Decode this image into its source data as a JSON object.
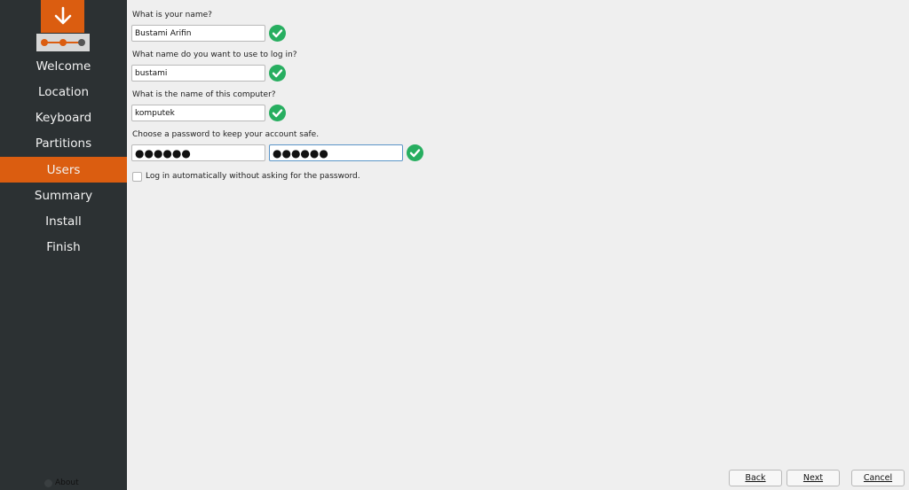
{
  "sidebar": {
    "items": [
      {
        "label": "Welcome",
        "active": false
      },
      {
        "label": "Location",
        "active": false
      },
      {
        "label": "Keyboard",
        "active": false
      },
      {
        "label": "Partitions",
        "active": false
      },
      {
        "label": "Users",
        "active": true
      },
      {
        "label": "Summary",
        "active": false
      },
      {
        "label": "Install",
        "active": false
      },
      {
        "label": "Finish",
        "active": false
      }
    ],
    "about_label": "About",
    "accent_color": "#db5d10",
    "background_color": "#2c3133"
  },
  "form": {
    "name": {
      "label": "What is your name?",
      "value": "Bustami Arifin",
      "valid": true
    },
    "login": {
      "label": "What name do you want to use to log in?",
      "value": "bustami",
      "valid": true
    },
    "computer": {
      "label": "What is the name of this computer?",
      "value": "komputek",
      "valid": true
    },
    "password": {
      "label": "Choose a password to keep your account safe.",
      "value": "●●●●●●",
      "confirm_value": "●●●●●●",
      "valid": true
    },
    "autologin": {
      "label": "Log in automatically without asking for the password.",
      "checked": false
    },
    "valid_color": "#27ae60",
    "valid_icon": "check-circle-icon"
  },
  "buttons": {
    "back": "Back",
    "next": "Next",
    "cancel": "Cancel"
  }
}
